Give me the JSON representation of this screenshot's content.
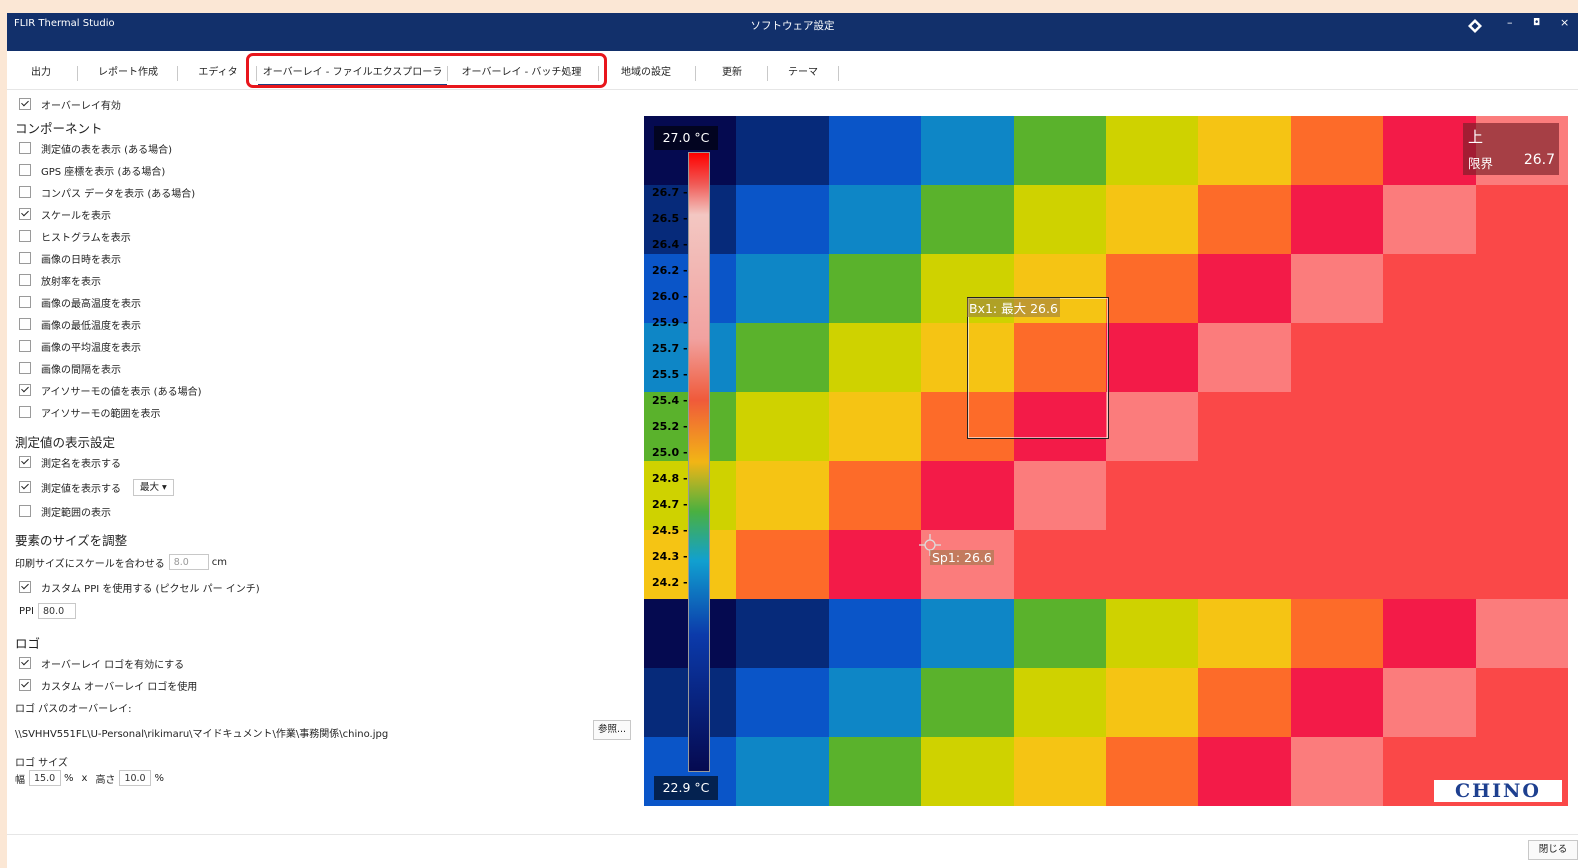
{
  "window": {
    "app_name": "FLIR Thermal Studio",
    "dialog_title": "ソフトウェア設定",
    "minimize": "–",
    "maximize": "◘",
    "close": "×"
  },
  "tabs": [
    {
      "label": "出力"
    },
    {
      "label": "レポート作成"
    },
    {
      "label": "エディタ"
    },
    {
      "label": "オーバーレイ - ファイルエクスプローラ",
      "active": true
    },
    {
      "label": "オーバーレイ - バッチ処理"
    },
    {
      "label": "地域の設定"
    },
    {
      "label": "更新"
    },
    {
      "label": "テーマ"
    }
  ],
  "overlay_enabled": {
    "label": "オーバーレイ有効",
    "checked": true
  },
  "components": {
    "heading": "コンポーネント",
    "items": [
      {
        "label": "測定値の表を表示 (ある場合)",
        "checked": false
      },
      {
        "label": "GPS 座標を表示 (ある場合)",
        "checked": false
      },
      {
        "label": "コンパス データを表示 (ある場合)",
        "checked": false
      },
      {
        "label": "スケールを表示",
        "checked": true
      },
      {
        "label": "ヒストグラムを表示",
        "checked": false
      },
      {
        "label": "画像の日時を表示",
        "checked": false
      },
      {
        "label": "放射率を表示",
        "checked": false
      },
      {
        "label": "画像の最高温度を表示",
        "checked": false
      },
      {
        "label": "画像の最低温度を表示",
        "checked": false
      },
      {
        "label": "画像の平均温度を表示",
        "checked": false
      },
      {
        "label": "画像の間隔を表示",
        "checked": false
      },
      {
        "label": "アイソサーモの値を表示 (ある場合)",
        "checked": true
      },
      {
        "label": "アイソサーモの範囲を表示",
        "checked": false
      }
    ]
  },
  "measurement": {
    "heading": "測定値の表示設定",
    "show_name": {
      "label": "測定名を表示する",
      "checked": true
    },
    "show_value": {
      "label": "測定値を表示する",
      "checked": true,
      "dropdown_value": "最大 ▾"
    },
    "show_range": {
      "label": "測定範囲の表示",
      "checked": false
    }
  },
  "size": {
    "heading": "要素のサイズを調整",
    "print_label": "印刷サイズにスケールを合わせる",
    "print_placeholder": "8.0",
    "print_unit": "cm",
    "custom_ppi": {
      "label": "カスタム PPI を使用する (ピクセル パー インチ)",
      "checked": true
    },
    "ppi_label": "PPI",
    "ppi_value": "80.0"
  },
  "logo": {
    "heading": "ロゴ",
    "enable": {
      "label": "オーバーレイ ロゴを有効にする",
      "checked": true
    },
    "custom": {
      "label": "カスタム オーバーレイ ロゴを使用",
      "checked": true
    },
    "path_label": "ロゴ パスのオーバーレイ:",
    "path_value": "\\\\SVHHV551FL\\U-Personal\\rikimaru\\マイドキュメント\\作業\\事務関係\\chino.jpg",
    "browse": "参照...",
    "size_label": "ロゴ サイズ",
    "width_label": "幅",
    "width_value": "15.0",
    "pct1": "%",
    "x": "x",
    "height_label": "高さ",
    "height_value": "10.0",
    "pct2": "%"
  },
  "thermal": {
    "max_label": "27.0 °C",
    "min_label": "22.9 °C",
    "scale_ticks": [
      "26.7",
      "26.5",
      "26.4",
      "26.2",
      "26.0",
      "25.9",
      "25.7",
      "25.5",
      "25.4",
      "25.2",
      "25.0",
      "24.8",
      "24.7",
      "24.5",
      "24.3",
      "24.2"
    ],
    "alarm_title": "上",
    "alarm_label": "限界",
    "alarm_value": "26.7",
    "bx_label": "Bx1: 最大 26.6",
    "sp_label": "Sp1: 26.6",
    "logo_text": "CHINO",
    "colors": {
      "navy": "#050a50",
      "darkblue": "#062a7a",
      "blue": "#0a55c8",
      "cyan": "#0e86c6",
      "green": "#5ab22c",
      "lime": "#cfd200",
      "yellow": "#f5c414",
      "orange": "#fd6b29",
      "red": "#f31b48",
      "pink": "#fb7c7c",
      "salmon": "#fa4848"
    }
  },
  "footer": {
    "close": "閉じる"
  }
}
